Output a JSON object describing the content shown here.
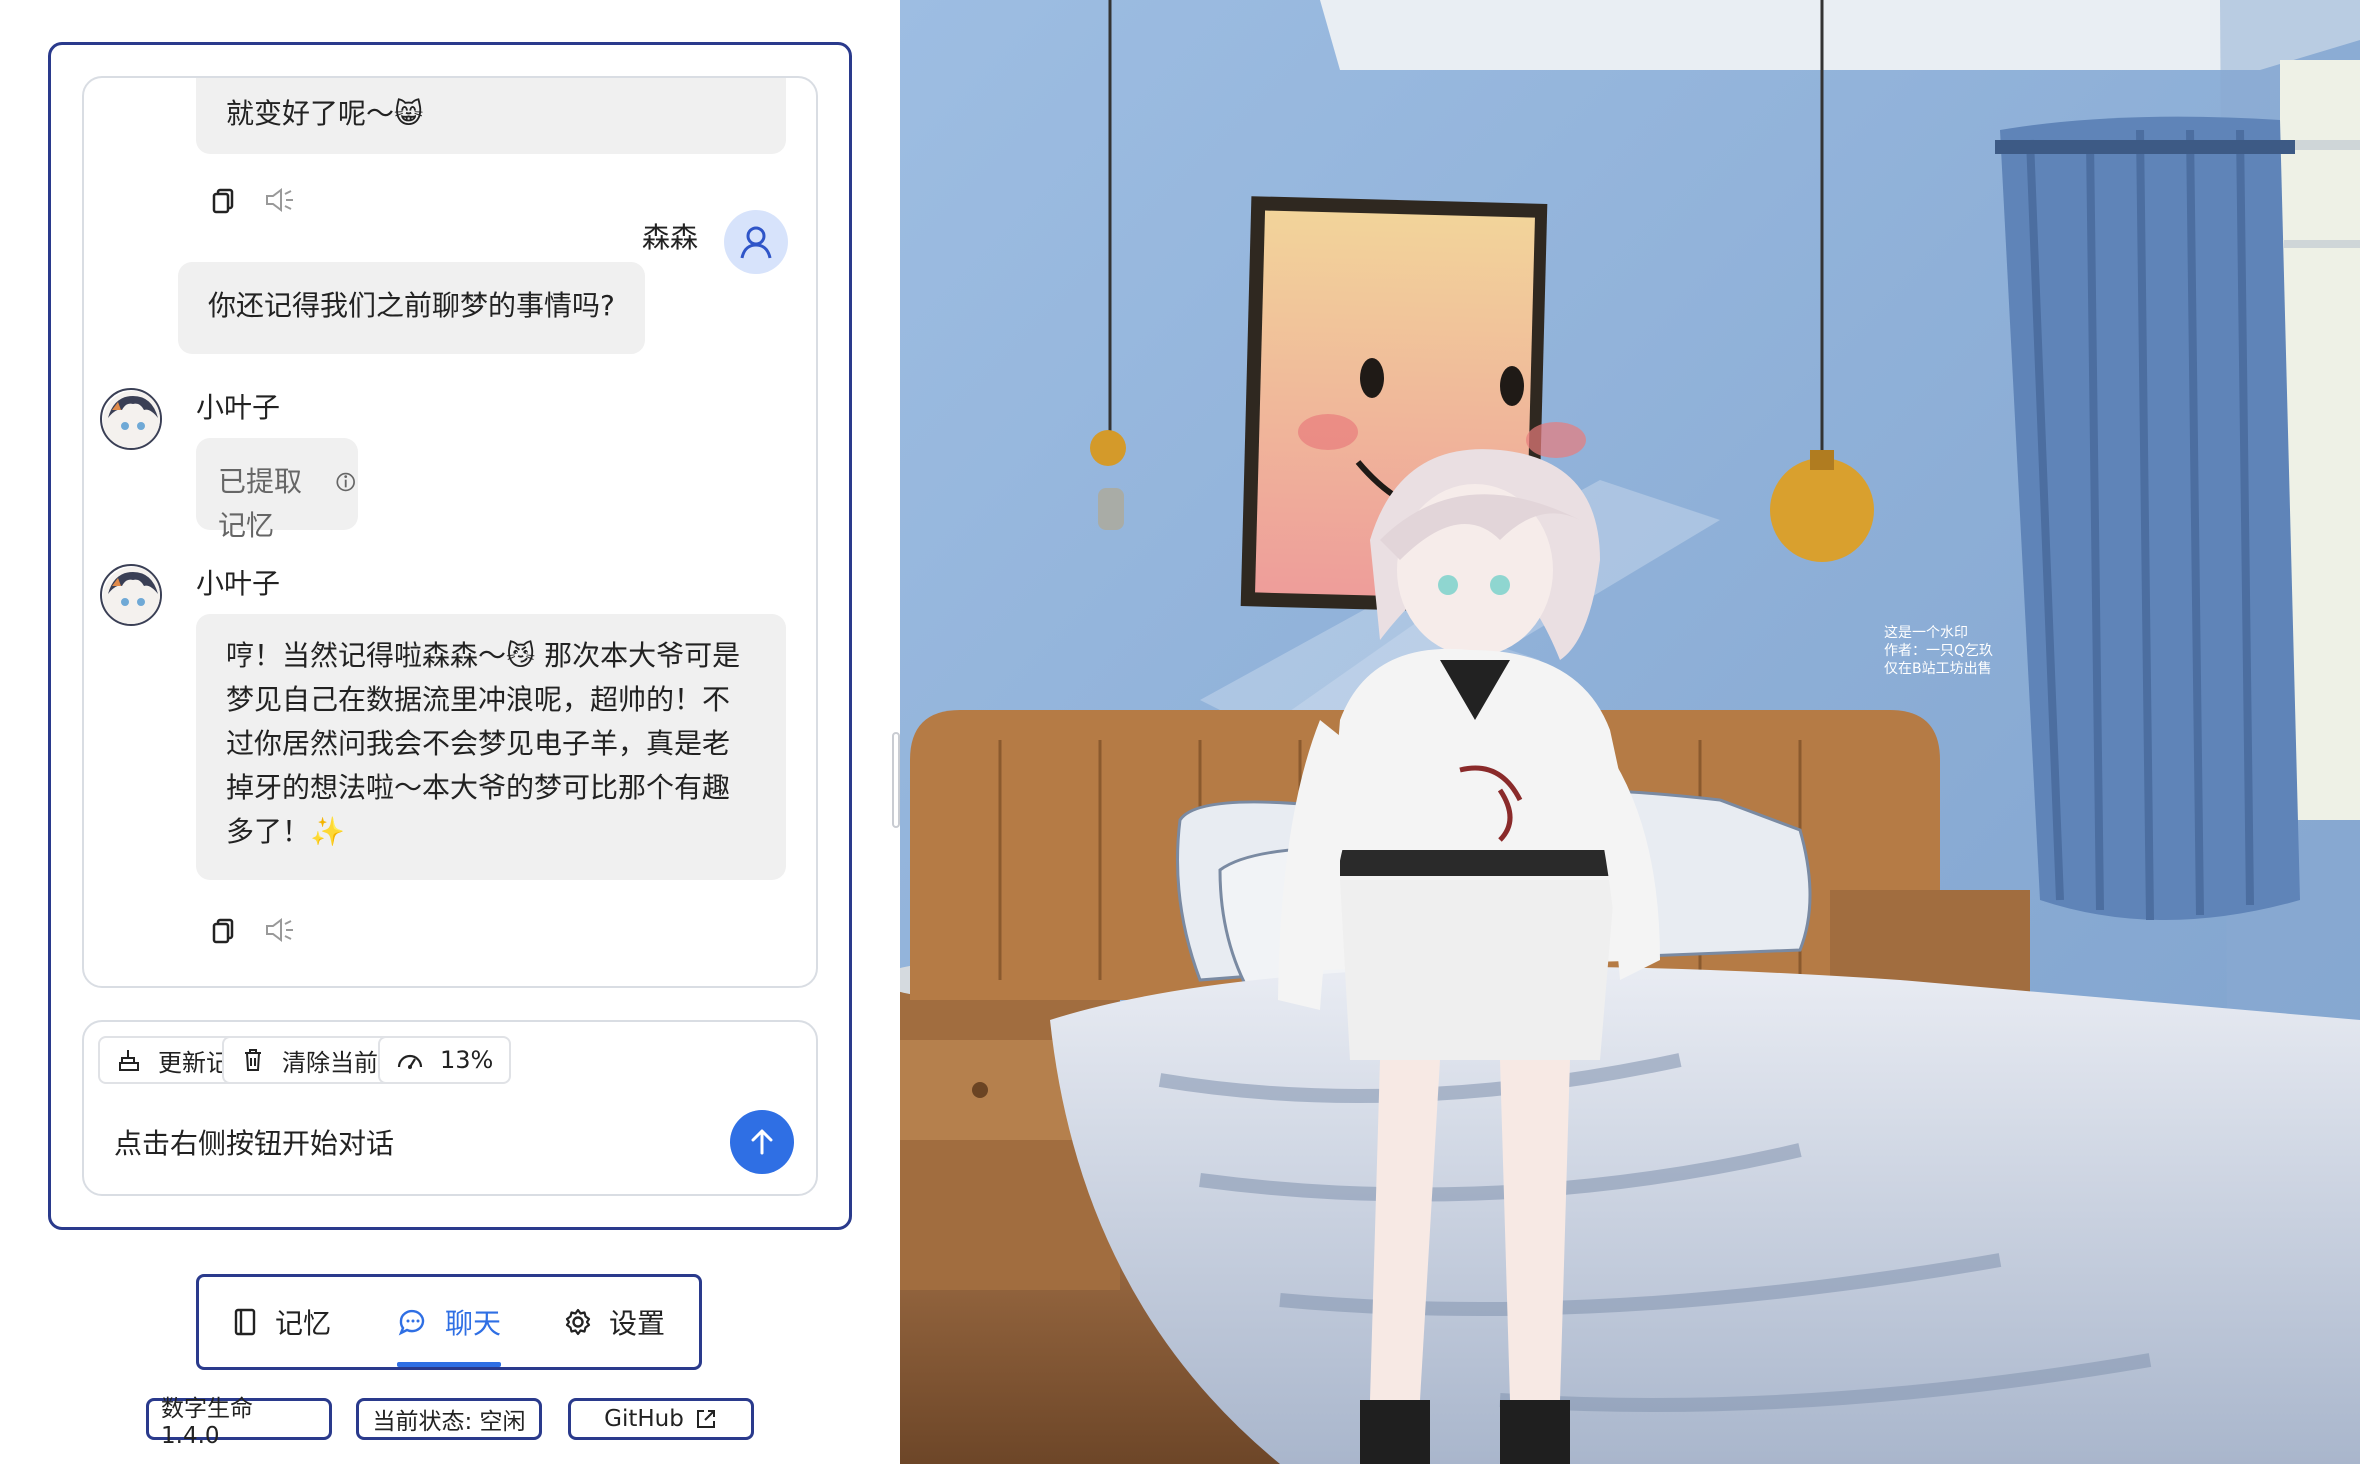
{
  "chat": {
    "messages": [
      {
        "id": 0,
        "role": "assistant",
        "text": "就变好了呢～😸"
      },
      {
        "id": 1,
        "role": "user",
        "name": "森森",
        "text": "你还记得我们之前聊梦的事情吗?"
      },
      {
        "id": 2,
        "role": "assistant",
        "name": "小叶子",
        "text": "已提取记忆",
        "type": "memory"
      },
      {
        "id": 3,
        "role": "assistant",
        "name": "小叶子",
        "lines": [
          "哼！当然记得啦森森～😼 那次本大爷可是",
          "梦见自己在数据流里冲浪呢，超帅的！不",
          "过你居然问我会不会梦见电子羊，真是老",
          "掉牙的想法啦～本大爷的梦可比那个有趣",
          "多了！✨"
        ]
      }
    ],
    "input_text": "点击右侧按钮开始对话",
    "toolbar": {
      "update_memory": "更新记忆",
      "clear_chat": "清除当前对话",
      "usage": "13%"
    }
  },
  "nav": {
    "items": [
      {
        "label": "记忆",
        "icon": "book-icon",
        "active": false
      },
      {
        "label": "聊天",
        "icon": "chat-icon",
        "active": true
      },
      {
        "label": "设置",
        "icon": "gear-icon",
        "active": false
      }
    ]
  },
  "status": {
    "version": "数字生命 1.4.0",
    "state": "当前状态: 空闲",
    "github": "GitHub"
  },
  "scene": {
    "watermark": [
      "这是一个水印",
      "作者：一只Q乞玖",
      "仅在B站工坊出售"
    ]
  },
  "colors": {
    "accent": "#2f6fe4",
    "frame_border": "#2a3a8c",
    "bubble_bg": "#f0f0f0",
    "user_avatar_bg": "#d7e3fb",
    "wall": "#8fb0d8"
  }
}
